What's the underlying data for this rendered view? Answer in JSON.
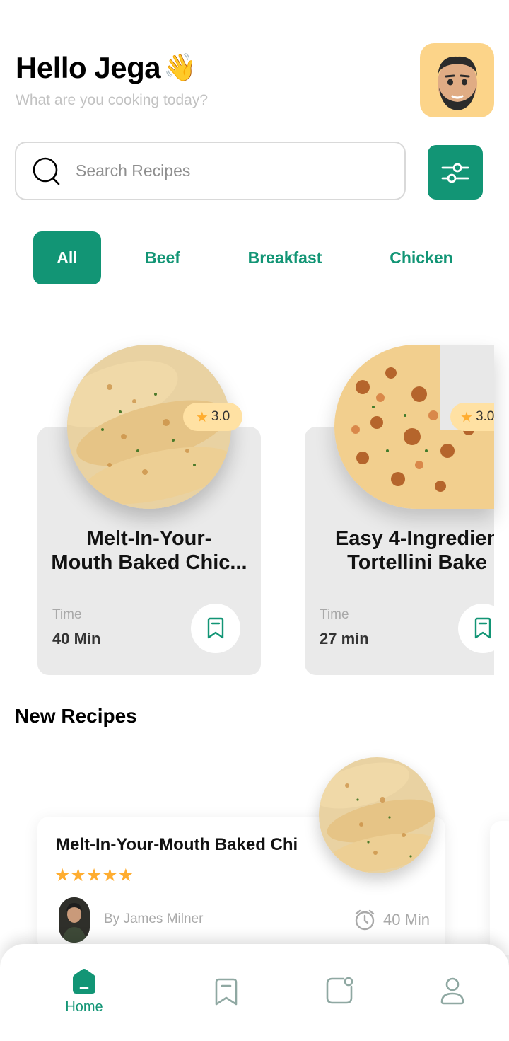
{
  "header": {
    "greeting": "Hello Jega",
    "wave_emoji": "👋",
    "subtitle": "What are you cooking today?"
  },
  "search": {
    "placeholder": "Search Recipes"
  },
  "categories": [
    "All",
    "Beef",
    "Breakfast",
    "Chicken"
  ],
  "featured": [
    {
      "title": "Melt-In-Your-\nMouth Baked Chic...",
      "rating": "3.0",
      "time_label": "Time",
      "time_value": "40 Min"
    },
    {
      "title": "Easy 4-Ingredien\nTortellini Bake",
      "rating": "3.0",
      "time_label": "Time",
      "time_value": "27 min"
    }
  ],
  "new_recipes": {
    "heading": "New Recipes",
    "item": {
      "title": "Melt-In-Your-Mouth Baked Chi",
      "stars": "★★★★★",
      "author": "By James Milner",
      "time": "40 Min"
    }
  },
  "nav": {
    "home_label": "Home"
  },
  "colors": {
    "accent": "#129575",
    "avatar_bg": "#fcd489",
    "rating_bg": "#ffe1a3",
    "star": "#ffad30"
  }
}
